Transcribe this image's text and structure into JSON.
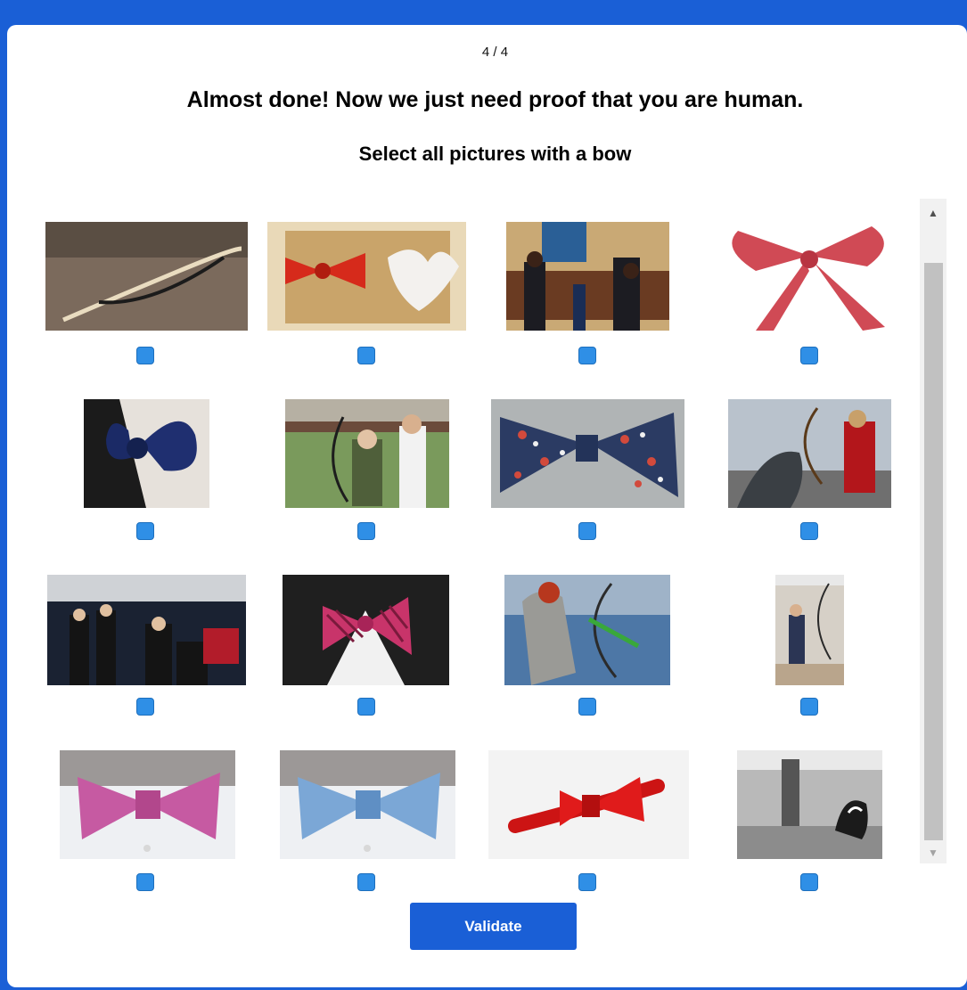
{
  "captcha": {
    "step": "4 / 4",
    "headline": "Almost done! Now we just need proof that you are human.",
    "instruction": "Select all pictures with a bow",
    "validate_label": "Validate",
    "scroll_up": "▲",
    "scroll_down": "▼",
    "checkbox_color": "#2f8fe6",
    "accent_color": "#1a5fd6"
  }
}
